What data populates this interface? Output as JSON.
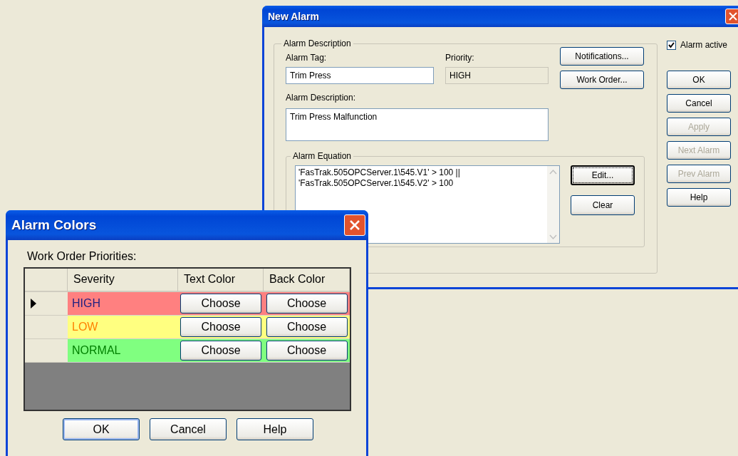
{
  "new_alarm": {
    "title": "New Alarm",
    "description_group": "Alarm Description",
    "alarm_tag": {
      "label": "Alarm Tag:",
      "value": "Trim Press"
    },
    "priority": {
      "label": "Priority:",
      "value": "HIGH"
    },
    "description": {
      "label": "Alarm Description:",
      "value": "Trim Press Malfunction"
    },
    "group_buttons": [
      {
        "label": "Notifications..."
      },
      {
        "label": "Work Order..."
      }
    ],
    "equation_group": "Alarm Equation",
    "equation_lines": [
      "'FasTrak.505OPCServer.1\\545.V1' > 100 ||",
      "'FasTrak.505OPCServer.1\\545.V2' > 100"
    ],
    "equation_buttons": [
      {
        "label": "Edit...",
        "focused": true
      },
      {
        "label": "Clear",
        "focused": false
      }
    ],
    "alarm_active": {
      "label": "Alarm active",
      "checked": true
    },
    "side_buttons": [
      {
        "label": "OK",
        "disabled": false
      },
      {
        "label": "Cancel",
        "disabled": false
      },
      {
        "label": "Apply",
        "disabled": true
      },
      {
        "label": "Next Alarm",
        "disabled": true
      },
      {
        "label": "Prev Alarm",
        "disabled": true
      },
      {
        "label": "Help",
        "disabled": false
      }
    ]
  },
  "alarm_colors": {
    "title": "Alarm Colors",
    "label": "Work Order Priorities:",
    "columns": [
      "Severity",
      "Text Color",
      "Back Color"
    ],
    "rows": [
      {
        "severity": "HIGH",
        "selected": true,
        "text": {
          "color": "#202080"
        },
        "fill": {
          "color": "#ff8080"
        },
        "text_button": "Choose",
        "back_button": "Choose"
      },
      {
        "severity": "LOW",
        "selected": false,
        "text": {
          "color": "#ff8000"
        },
        "fill": {
          "color": "#ffff80"
        },
        "text_button": "Choose",
        "back_button": "Choose"
      },
      {
        "severity": "NORMAL",
        "selected": false,
        "text": {
          "color": "#008000"
        },
        "fill": {
          "color": "#80ff80"
        },
        "text_button": "Choose",
        "back_button": "Choose"
      }
    ],
    "buttons": [
      {
        "label": "OK",
        "default": true
      },
      {
        "label": "Cancel",
        "default": false
      },
      {
        "label": "Help",
        "default": false
      }
    ]
  }
}
